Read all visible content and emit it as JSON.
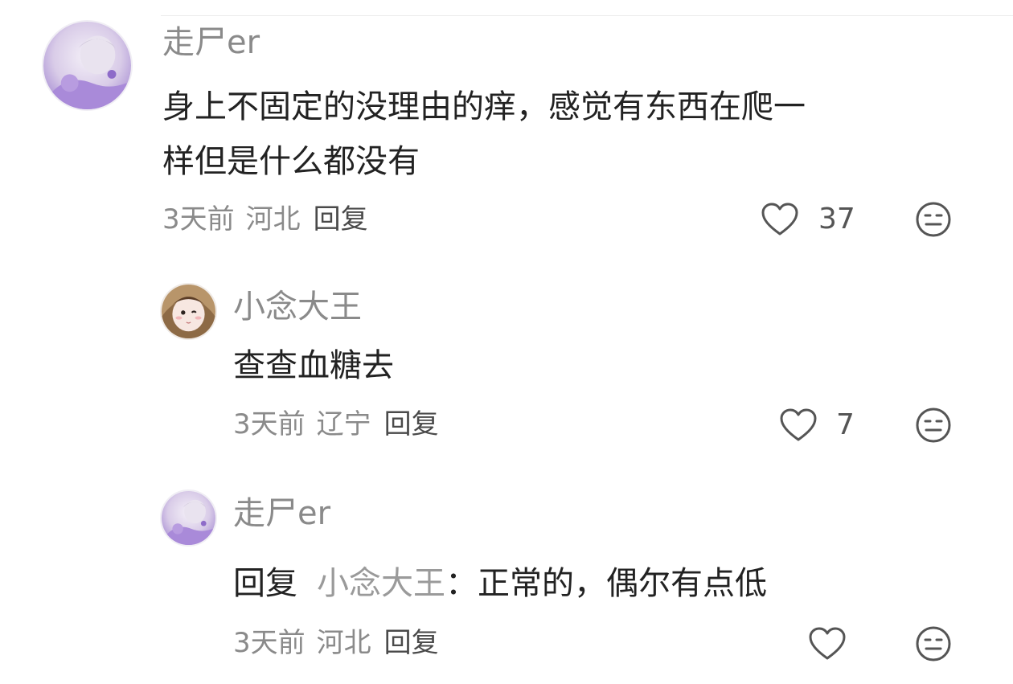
{
  "comments": [
    {
      "username": "走尸er",
      "text_line1": "身上不固定的没理由的痒，感觉有东西在爬一",
      "text_line2": "样但是什么都没有",
      "time": "3天前",
      "location": "河北",
      "reply_label": "回复",
      "likes": "37"
    },
    {
      "username": "小念大王",
      "text": "查查血糖去",
      "time": "3天前",
      "location": "辽宁",
      "reply_label": "回复",
      "likes": "7"
    },
    {
      "username": "走尸er",
      "reply_prefix": "回复",
      "reply_target": "小念大王",
      "reply_sep": "：",
      "text": "正常的，偶尔有点低",
      "time": "3天前",
      "location": "河北",
      "reply_label": "回复",
      "likes": ""
    }
  ],
  "icons": {
    "like": "heart-outline-icon",
    "dislike": "meh-face-icon"
  },
  "colors": {
    "username": "#8a8a8a",
    "text": "#222222",
    "meta": "#8a8a8a",
    "icon": "#555555"
  }
}
